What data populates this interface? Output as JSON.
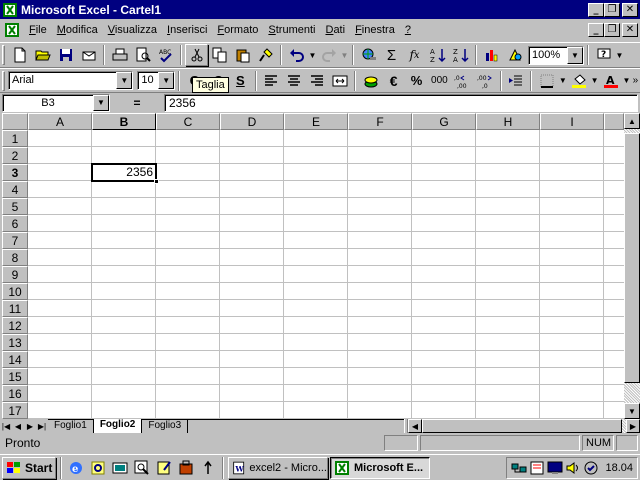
{
  "window": {
    "title": "Microsoft Excel - Cartel1"
  },
  "menu": {
    "items": [
      {
        "label": "File",
        "u": "F",
        "rest": "ile"
      },
      {
        "label": "Modifica",
        "u": "M",
        "rest": "odifica"
      },
      {
        "label": "Visualizza",
        "u": "V",
        "rest": "isualizza"
      },
      {
        "label": "Inserisci",
        "u": "I",
        "rest": "nserisci"
      },
      {
        "label": "Formato",
        "u": "F",
        "rest": "ormato"
      },
      {
        "label": "Strumenti",
        "u": "S",
        "rest": "trumenti"
      },
      {
        "label": "Dati",
        "u": "D",
        "rest": "ati"
      },
      {
        "label": "Finestra",
        "u": "F",
        "rest": "inestra"
      },
      {
        "label": "?",
        "u": "?",
        "rest": ""
      }
    ]
  },
  "toolbar": {
    "zoom": "100%",
    "font_name": "Arial",
    "font_size": "10",
    "tooltip": "Taglia",
    "euro": "€",
    "percent": "%",
    "thousands": "000",
    "bold": "G",
    "underline": "S"
  },
  "formula_bar": {
    "name_box": "B3",
    "equals": "=",
    "content": "2356"
  },
  "grid": {
    "columns": [
      "A",
      "B",
      "C",
      "D",
      "E",
      "F",
      "G",
      "H",
      "I"
    ],
    "rows": [
      "1",
      "2",
      "3",
      "4",
      "5",
      "6",
      "7",
      "8",
      "9",
      "10",
      "11",
      "12",
      "13",
      "14",
      "15",
      "16",
      "17"
    ],
    "active_column": "B",
    "active_row": "3",
    "active_cell_value": "2356"
  },
  "sheets": {
    "tabs": [
      "Foglio1",
      "Foglio2",
      "Foglio3"
    ],
    "active": "Foglio2"
  },
  "status": {
    "text": "Pronto",
    "num": "NUM"
  },
  "taskbar": {
    "start": "Start",
    "buttons": [
      {
        "label": "excel2 - Micro...",
        "active": false
      },
      {
        "label": "Microsoft E...",
        "active": true
      }
    ],
    "clock": "18.04"
  },
  "colors": {
    "titlebar": "#000080",
    "face": "#c0c0c0",
    "tooltip": "#ffffe1"
  }
}
